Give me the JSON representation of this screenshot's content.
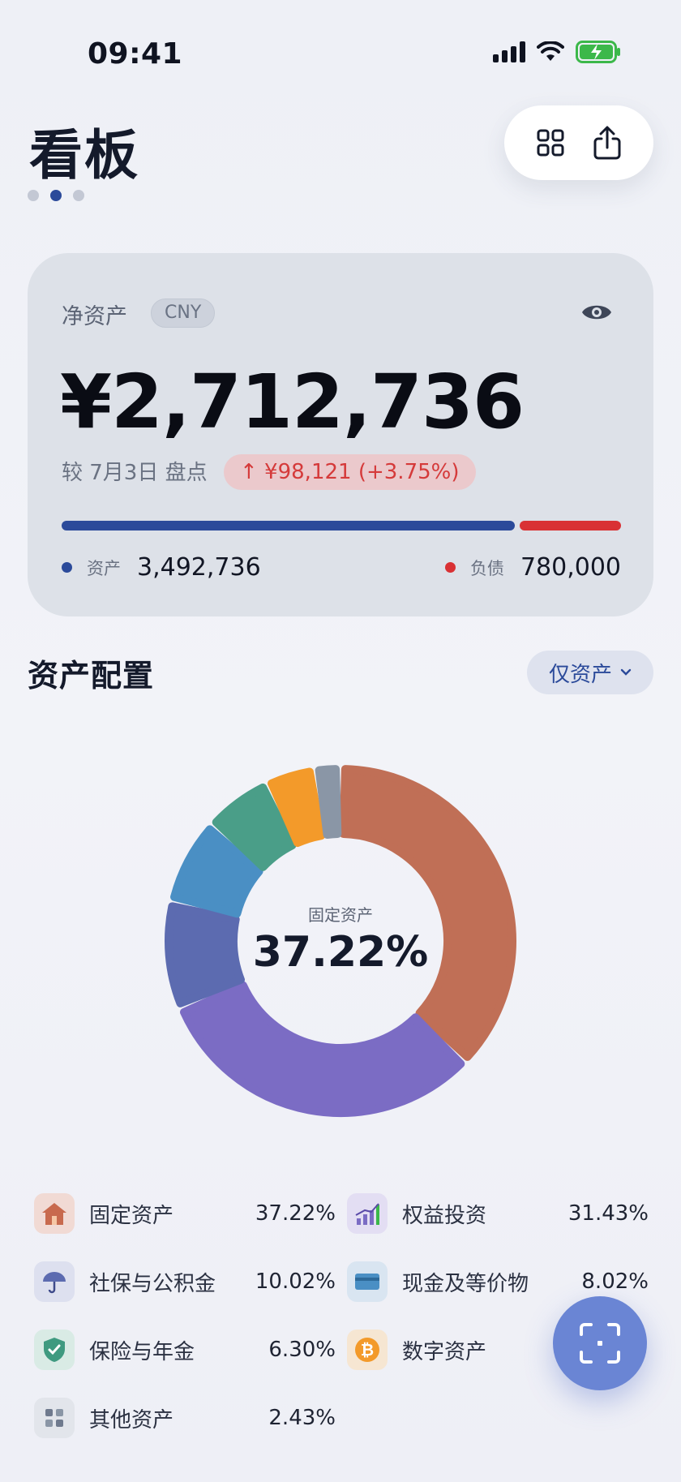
{
  "status_bar": {
    "time": "09:41"
  },
  "header": {
    "title": "看板",
    "page_count": 3,
    "active_page": 2,
    "actions": [
      "grid-icon",
      "share-icon"
    ]
  },
  "net_worth": {
    "label": "净资产",
    "currency": "CNY",
    "value": "¥2,712,736",
    "compare_text": "较 7月3日 盘点",
    "change_text": "↑ ¥98,121 (+3.75%)",
    "assets_label": "资产",
    "assets_value": "3,492,736",
    "liabilities_label": "负债",
    "liabilities_value": "780,000",
    "assets_fraction": 0.817,
    "colors": {
      "assets": "#2b4a9a",
      "liabilities": "#d93134"
    }
  },
  "allocation": {
    "title": "资产配置",
    "filter_label": "仅资产",
    "center_label": "固定资产",
    "center_value": "37.22%",
    "items": [
      {
        "name": "固定资产",
        "pct": "37.22%",
        "icon": "house-icon",
        "color": "#c06f56"
      },
      {
        "name": "权益投资",
        "pct": "31.43%",
        "icon": "chart-icon",
        "color": "#7b6cc4"
      },
      {
        "name": "社保与公积金",
        "pct": "10.02%",
        "icon": "umbrella-icon",
        "color": "#5c6bb0"
      },
      {
        "name": "现金及等价物",
        "pct": "8.02%",
        "icon": "card-icon",
        "color": "#4a8fc4"
      },
      {
        "name": "保险与年金",
        "pct": "6.30%",
        "icon": "shield-icon",
        "color": "#4a9e88"
      },
      {
        "name": "数字资产",
        "pct": "4.58%",
        "icon": "bitcoin-icon",
        "color": "#f39a2a"
      },
      {
        "name": "其他资产",
        "pct": "2.43%",
        "icon": "grid-squares-icon",
        "color": "#8a96a6"
      }
    ]
  },
  "fab": {
    "icon": "scan-icon"
  }
}
